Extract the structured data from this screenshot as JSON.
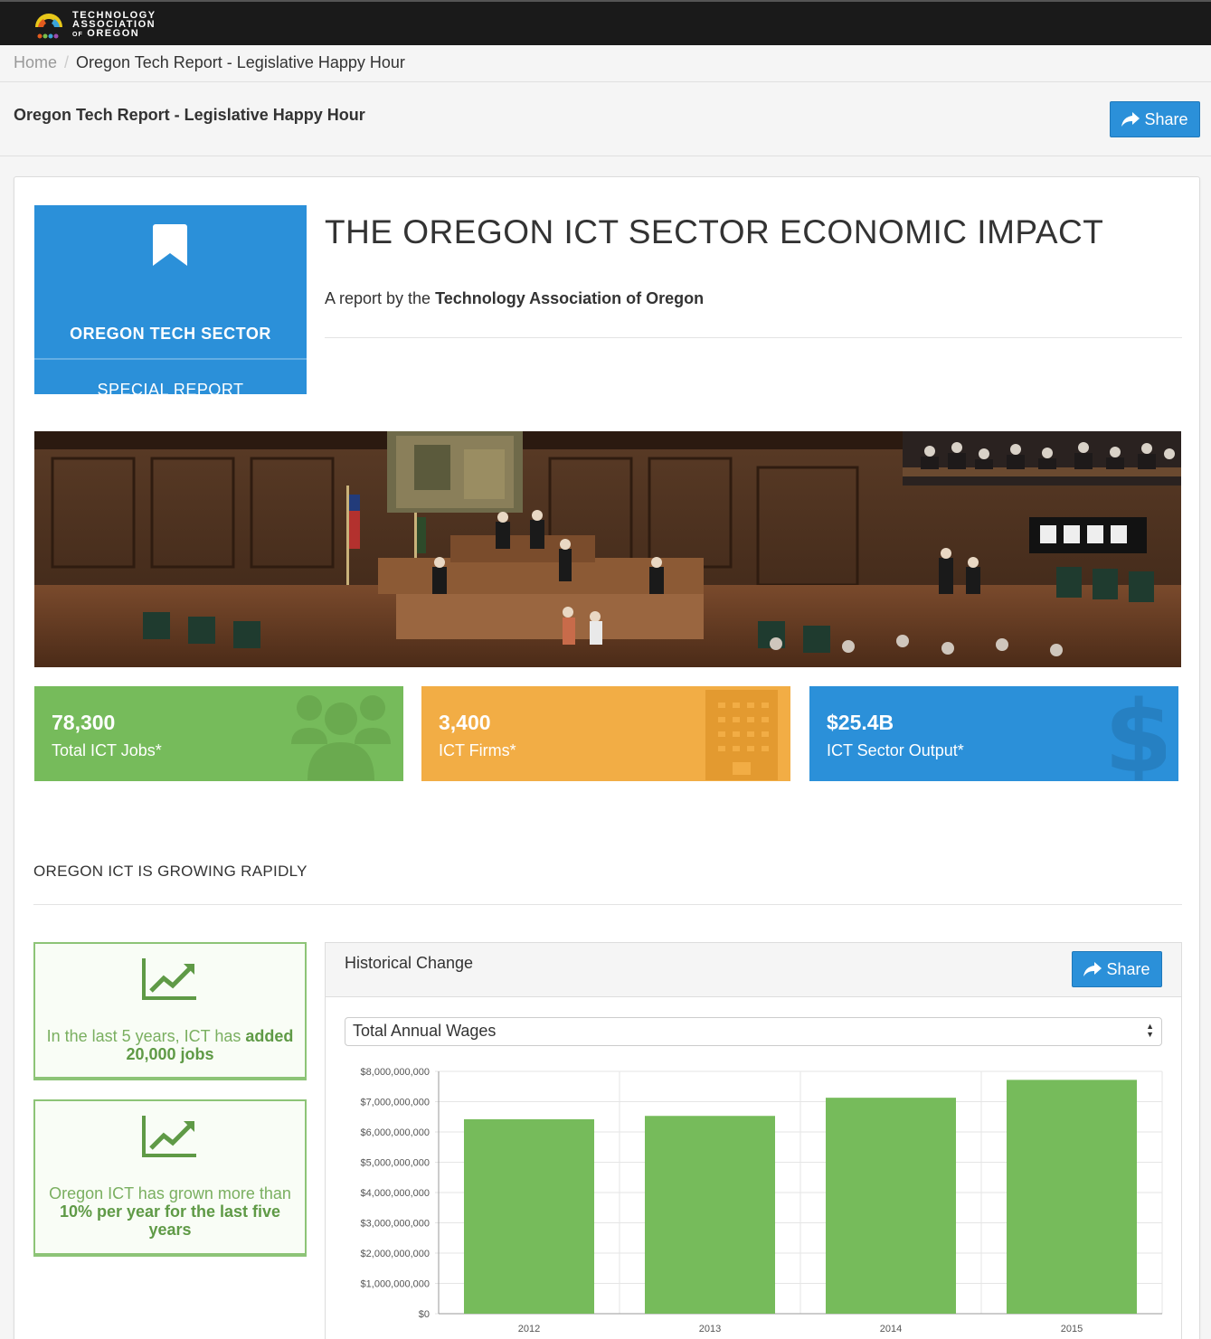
{
  "topbar": {
    "logo_lines": [
      "TECHNOLOGY",
      "ASSOCIATION",
      "OF",
      "OREGON"
    ]
  },
  "breadcrumb": {
    "home": "Home",
    "separator": "/",
    "current": "Oregon Tech Report - Legislative Happy Hour"
  },
  "page_header": {
    "title": "Oregon Tech Report - Legislative Happy Hour",
    "share_label": "Share"
  },
  "badge": {
    "icon": "bookmark-icon",
    "line1": "OREGON TECH SECTOR",
    "line2": "SPECIAL REPORT"
  },
  "report": {
    "headline": "THE OREGON ICT SECTOR ECONOMIC IMPACT",
    "byline_prefix": "A report by the ",
    "byline_org": "Technology Association of Oregon"
  },
  "stats": [
    {
      "value": "78,300",
      "label": "Total ICT Jobs*",
      "icon": "users-icon",
      "color": "#76bb5b"
    },
    {
      "value": "3,400",
      "label": "ICT Firms*",
      "icon": "building-icon",
      "color": "#f2ad45"
    },
    {
      "value": "$25.4B",
      "label": "ICT Sector Output*",
      "icon": "dollar-icon",
      "color": "#2b90d9"
    }
  ],
  "section": {
    "title": "OREGON ICT IS GROWING RAPIDLY"
  },
  "insights": [
    {
      "icon": "line-chart-icon",
      "text_pre": "In the last 5 years, ICT has ",
      "text_bold": "added 20,000 jobs",
      "text_post": ""
    },
    {
      "icon": "line-chart-icon",
      "text_pre": "Oregon ICT has grown more than ",
      "text_bold": "10% per year for the last five years",
      "text_post": ""
    }
  ],
  "panel": {
    "title": "Historical Change",
    "share_label": "Share",
    "select_value": "Total Annual Wages"
  },
  "chart_data": {
    "type": "bar",
    "categories": [
      "2012",
      "2013",
      "2014",
      "2015"
    ],
    "values": [
      6420000000,
      6530000000,
      7130000000,
      7720000000
    ],
    "ylim": [
      0,
      8000000000
    ],
    "yticks": [
      "$0",
      "$1,000,000,000",
      "$2,000,000,000",
      "$3,000,000,000",
      "$4,000,000,000",
      "$5,000,000,000",
      "$6,000,000,000",
      "$7,000,000,000",
      "$8,000,000,000"
    ],
    "bar_color": "#76bb5b",
    "grid": true
  }
}
